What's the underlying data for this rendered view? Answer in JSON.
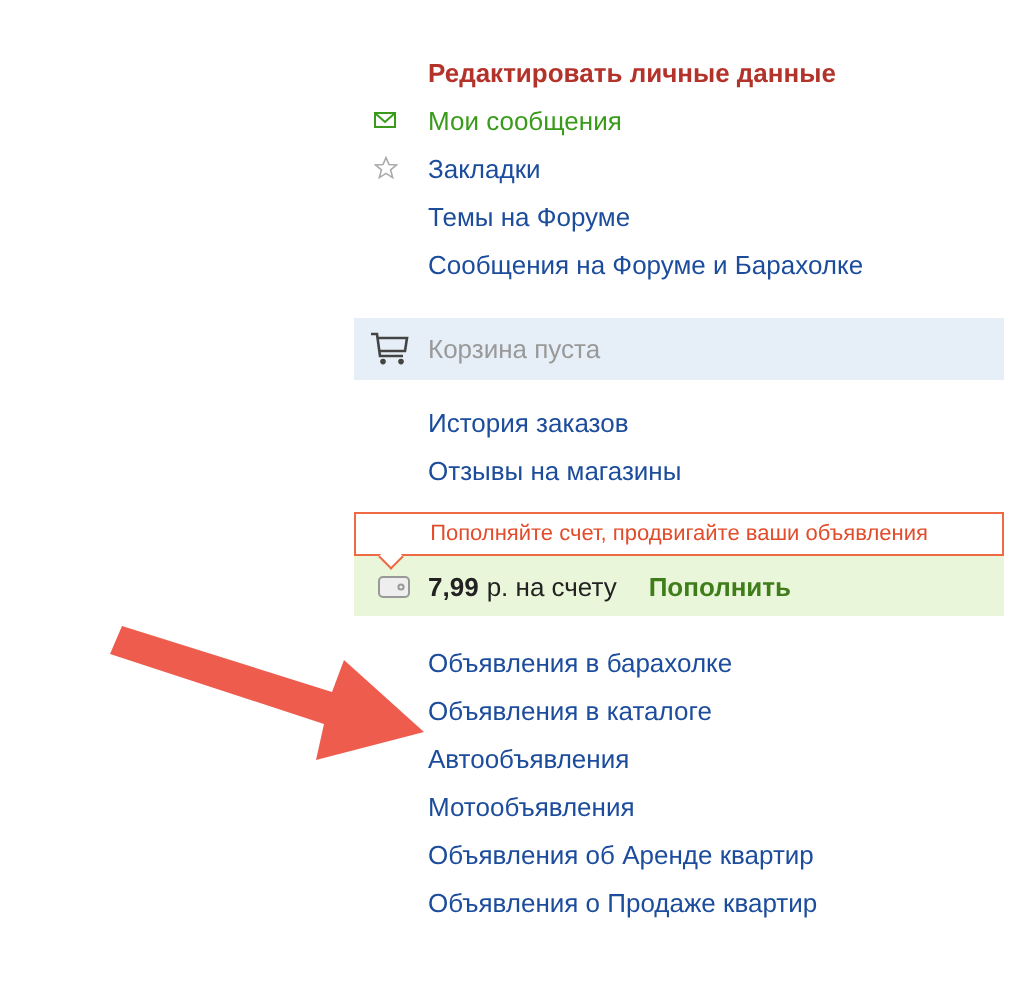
{
  "profile_links": [
    {
      "label": "Редактировать личные данные",
      "kind": "edit"
    },
    {
      "label": "Мои сообщения",
      "kind": "messages"
    },
    {
      "label": "Закладки",
      "kind": "bookmarks"
    },
    {
      "label": "Темы на Форуме",
      "kind": "plain"
    },
    {
      "label": "Сообщения на Форуме и Барахолке",
      "kind": "plain"
    }
  ],
  "cart": {
    "label": "Корзина пуста"
  },
  "shop_links": [
    "История заказов",
    "Отзывы на магазины"
  ],
  "balance": {
    "tooltip": "Пополняйте счет, продвигайте ваши объявления",
    "amount": "7,99",
    "unit": "р. на счету",
    "action": "Пополнить"
  },
  "ad_links": [
    "Объявления в барахолке",
    "Объявления в каталоге",
    "Автообъявления",
    "Мотообъявления",
    "Объявления об Аренде квартир",
    "Объявления о Продаже квартир"
  ],
  "annotation": {
    "kind": "arrow"
  }
}
